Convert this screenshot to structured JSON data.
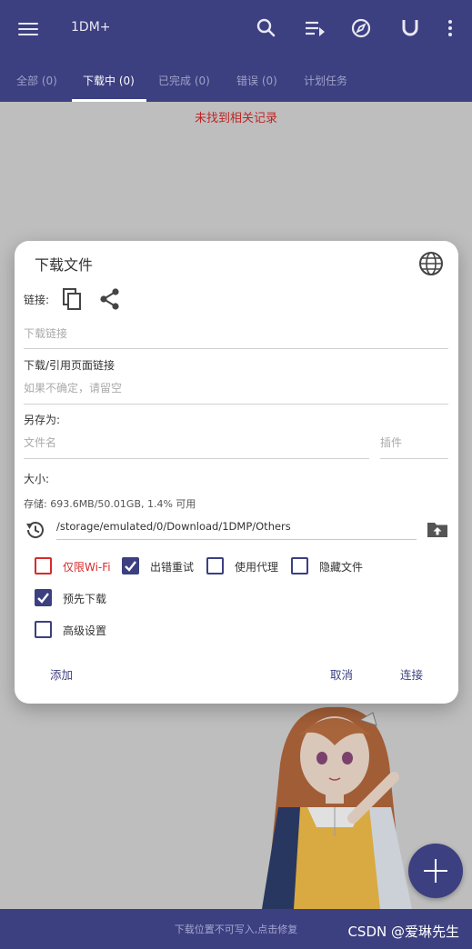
{
  "appbar": {
    "title": "1DM+",
    "icons": [
      "menu-icon",
      "search-icon",
      "queue-icon",
      "compass-icon",
      "magnet-icon",
      "more-icon"
    ]
  },
  "tabs": [
    {
      "label": "全部 (0)",
      "active": false
    },
    {
      "label": "下载中 (0)",
      "active": true
    },
    {
      "label": "已完成 (0)",
      "active": false
    },
    {
      "label": "错误 (0)",
      "active": false
    },
    {
      "label": "计划任务",
      "active": false
    }
  ],
  "empty_message": "未找到相关记录",
  "dialog": {
    "title": "下载文件",
    "link_label": "链接:",
    "link_placeholder": "下载链接",
    "referer_label": "下载/引用页面链接",
    "referer_placeholder": "如果不确定，请留空",
    "saveas_label": "另存为:",
    "filename_placeholder": "文件名",
    "plugin_placeholder": "插件",
    "size_label": "大小:",
    "storage_text": "存储: 693.6MB/50.01GB, 1.4% 可用",
    "path": "/storage/emulated/0/Download/1DMP/Others",
    "checkboxes": [
      {
        "label": "仅限Wi-Fi",
        "checked": false
      },
      {
        "label": "出错重试",
        "checked": true
      },
      {
        "label": "使用代理",
        "checked": false
      },
      {
        "label": "隐藏文件",
        "checked": false
      },
      {
        "label": "预先下载",
        "checked": true
      },
      {
        "label": "高级设置",
        "checked": false
      }
    ],
    "buttons": {
      "add": "添加",
      "cancel": "取消",
      "connect": "连接"
    }
  },
  "bottombar": {
    "warning": "下载位置不可写入,点击修复",
    "watermark": "CSDN @爱琳先生"
  },
  "colors": {
    "primary": "#3c3f80",
    "error": "#d82a2a",
    "background": "#d9d9d9"
  }
}
